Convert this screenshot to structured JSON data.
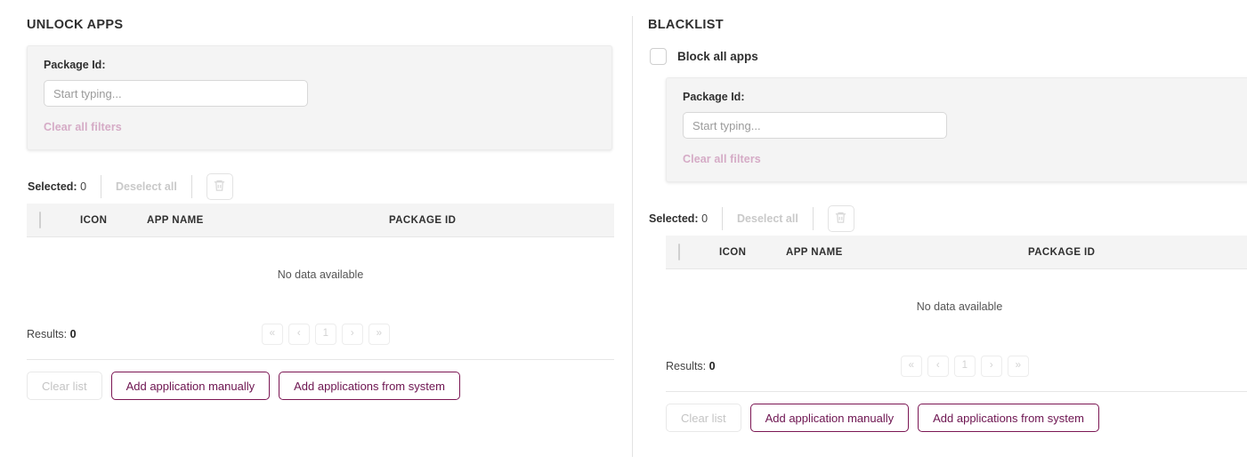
{
  "theme": {
    "accent": "#6d1450",
    "accent_border": "#7b1653",
    "card_bg": "#f4f4f4",
    "disabled_text": "#c4c4c4",
    "muted_link": "#d5abc6"
  },
  "unlock_panel": {
    "title": "UNLOCK APPS",
    "filter": {
      "label": "Package Id:",
      "input_value": "",
      "placeholder": "Start typing...",
      "clear_filters_label": "Clear all filters"
    },
    "toolbar": {
      "selected_label": "Selected:",
      "selected_count": "0",
      "deselect_all_label": "Deselect all",
      "delete_icon": "trash-icon"
    },
    "table": {
      "columns": [
        "ICON",
        "APP NAME",
        "PACKAGE ID"
      ],
      "rows": [],
      "empty_message": "No data available"
    },
    "pagination": {
      "results_label": "Results:",
      "results_count": "0",
      "first_label": "«",
      "prev_label": "‹",
      "current_page": "1",
      "next_label": "›",
      "last_label": "»"
    },
    "actions": {
      "clear_list": "Clear list",
      "add_manually": "Add application manually",
      "add_from_system": "Add applications from system"
    }
  },
  "blacklist_panel": {
    "title": "BLACKLIST",
    "block_all": {
      "label": "Block all apps",
      "checked": false
    },
    "filter": {
      "label": "Package Id:",
      "input_value": "",
      "placeholder": "Start typing...",
      "clear_filters_label": "Clear all filters"
    },
    "toolbar": {
      "selected_label": "Selected:",
      "selected_count": "0",
      "deselect_all_label": "Deselect all",
      "delete_icon": "trash-icon"
    },
    "table": {
      "columns": [
        "ICON",
        "APP NAME",
        "PACKAGE ID"
      ],
      "rows": [],
      "empty_message": "No data available"
    },
    "pagination": {
      "results_label": "Results:",
      "results_count": "0",
      "first_label": "«",
      "prev_label": "‹",
      "current_page": "1",
      "next_label": "›",
      "last_label": "»"
    },
    "actions": {
      "clear_list": "Clear list",
      "add_manually": "Add application manually",
      "add_from_system": "Add applications from system"
    }
  }
}
